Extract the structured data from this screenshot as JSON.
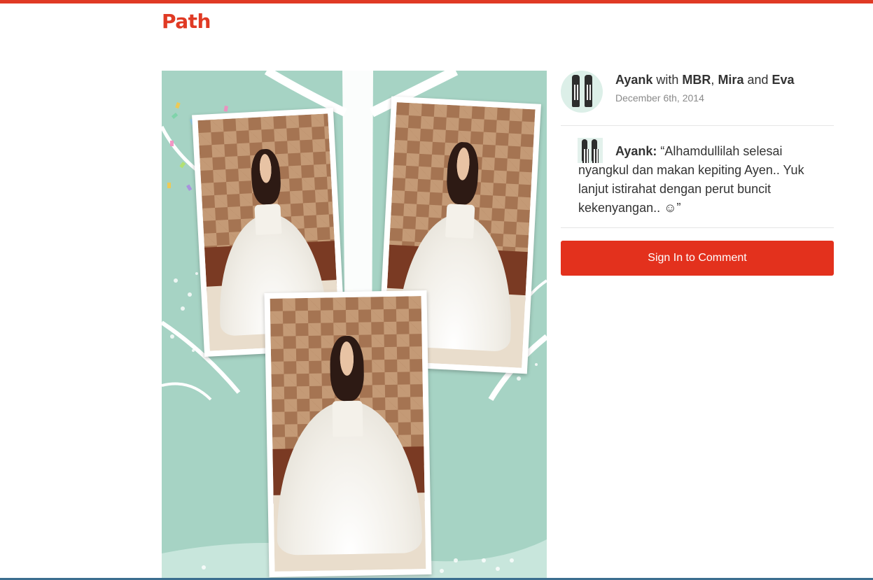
{
  "header": {
    "logo_text": "Path",
    "brand_color": "#e03a24"
  },
  "post": {
    "author": "Ayank",
    "with_word": "with",
    "companions": [
      "MBR",
      "Mira",
      "Eva"
    ],
    "separator": ",",
    "and_word": "and",
    "date": "December 6th, 2014"
  },
  "comment": {
    "author_label": "Ayank:",
    "text": "“Alhamdullilah selesai nyangkul dan makan kepiting Ayen.. Yuk lanjut istirahat dengan perut buncit kekenyangan.. ☺”"
  },
  "actions": {
    "sign_in_label": "Sign In to Comment",
    "button_color": "#e3311d"
  },
  "photo": {
    "background_color": "#a6d3c4",
    "panel_count": 3
  }
}
